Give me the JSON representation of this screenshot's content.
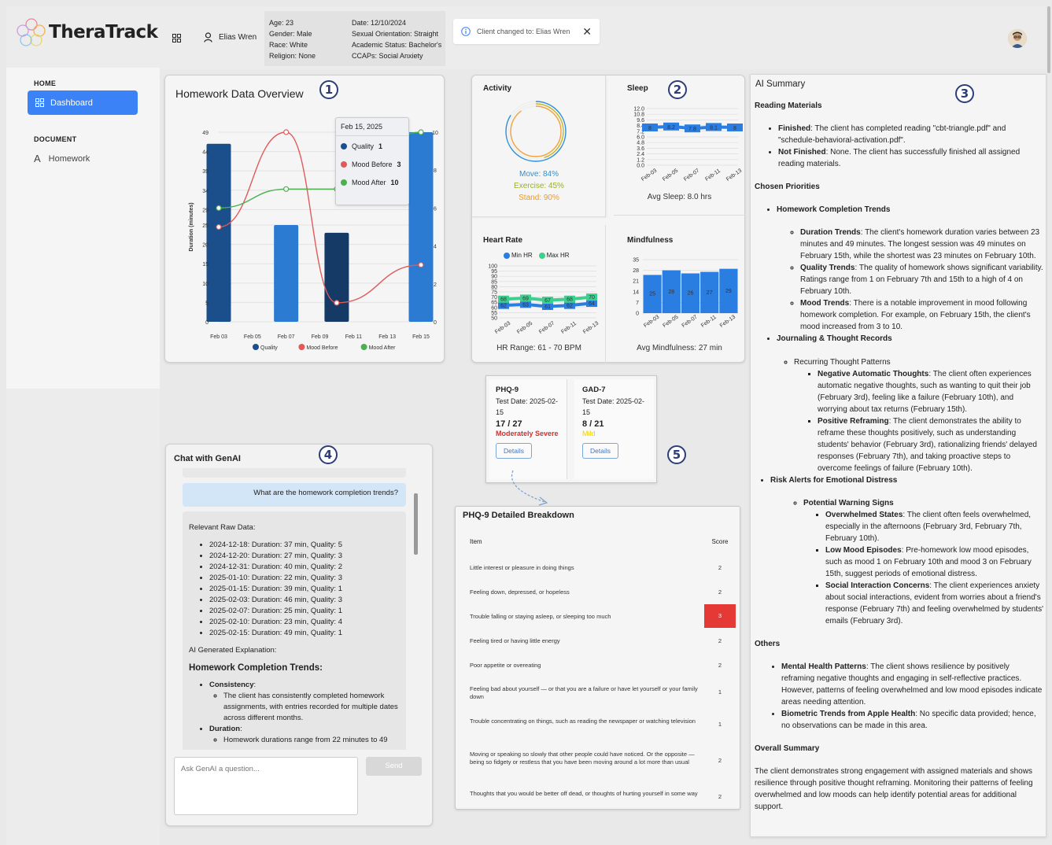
{
  "app": {
    "name": "TheraTrack"
  },
  "sidebar": {
    "section_home": "HOME",
    "dashboard": "Dashboard",
    "section_document": "DOCUMENT",
    "homework": "Homework"
  },
  "header": {
    "client_name": "Elias Wren",
    "age": "Age: 23",
    "gender": "Gender: Male",
    "race": "Race: White",
    "religion": "Religion: None",
    "date": "Date: 12/10/2024",
    "orientation": "Sexual Orientation: Straight",
    "academic": "Academic Status: Bachelor's",
    "ccaps": "CCAPs: Social Anxiety",
    "toast": "Client changed to: Elias Wren"
  },
  "badges": [
    "1",
    "2",
    "3",
    "4",
    "5"
  ],
  "homework_chart": {
    "title": "Homework Data Overview",
    "chart_data": {
      "type": "bar",
      "title": "Homework Data Overview",
      "categories": [
        "Feb 03",
        "Feb 05",
        "Feb 07",
        "Feb 09",
        "Feb 11",
        "Feb 13",
        "Feb 15"
      ],
      "ylabel": "Duration (minutes)",
      "y2label": "Mood Rating (1–10)",
      "y_ticks": [
        "0",
        "5",
        "10",
        "15",
        "20",
        "25",
        "29",
        "34",
        "39",
        "44",
        "49"
      ],
      "y2_ticks": [
        "0",
        "2",
        "4",
        "6",
        "8",
        "10"
      ],
      "ylim": [
        0,
        49
      ],
      "y2lim": [
        0,
        10
      ],
      "series": [
        {
          "name": "Quality",
          "type": "bar",
          "x": [
            "2025-02-03",
            "2025-02-07",
            "2025-02-10",
            "2025-02-15"
          ],
          "values": [
            46,
            25,
            23,
            49
          ],
          "colors": [
            "#1a4f8b",
            "#2a7bd1",
            "#163a66",
            "#2a7bd1"
          ]
        },
        {
          "name": "Mood Before",
          "type": "line",
          "color": "#e05a5a",
          "x": [
            "2025-02-03",
            "2025-02-07",
            "2025-02-10",
            "2025-02-15"
          ],
          "values": [
            5,
            10,
            1,
            3
          ]
        },
        {
          "name": "Mood After",
          "type": "line",
          "color": "#4caf50",
          "x": [
            "2025-02-03",
            "2025-02-07",
            "2025-02-10",
            "2025-02-15"
          ],
          "values": [
            6,
            7,
            7,
            10
          ]
        }
      ],
      "legend_position": "bottom"
    },
    "tooltip": {
      "date": "Feb 15, 2025",
      "quality_label": "Quality",
      "quality_value": "1",
      "mood_before_label": "Mood Before",
      "mood_before_value": "3",
      "mood_after_label": "Mood After",
      "mood_after_value": "10"
    },
    "legend": [
      "Quality",
      "Mood Before",
      "Mood After"
    ]
  },
  "activity": {
    "title": "Activity",
    "move": "Move: 84%",
    "exercise": "Exercise: 45%",
    "stand": "Stand: 90%",
    "rings": [
      0.84,
      0.45,
      0.9
    ],
    "ring_colors": [
      "#2a8fd8",
      "#c9b62e",
      "#f2a33a"
    ]
  },
  "sleep": {
    "title": "Sleep",
    "footer": "Avg Sleep: 8.0 hrs",
    "chart_data": {
      "type": "line",
      "title": "",
      "categories": [
        "Feb-03",
        "Feb-05",
        "Feb-07",
        "Feb-11",
        "Feb-13"
      ],
      "values": [
        8,
        8.2,
        7.8,
        8.1,
        8
      ],
      "labels": [
        "8",
        "8.2",
        "7.8",
        "8.1",
        "8"
      ],
      "y_ticks": [
        "12.0",
        "10.8",
        "9.6",
        "8.4",
        "7.2",
        "6.0",
        "4.8",
        "3.6",
        "2.4",
        "1.2",
        "0.0"
      ],
      "ylim": [
        0,
        12
      ]
    }
  },
  "heart": {
    "title": "Heart Rate",
    "footer": "HR Range: 61 - 70 BPM",
    "legend_min": "Min HR",
    "legend_max": "Max HR",
    "chart_data": {
      "type": "line",
      "title": "",
      "categories": [
        "Feb-03",
        "Feb-05",
        "Feb-07",
        "Feb-11",
        "Feb-13"
      ],
      "series": [
        {
          "name": "Min HR",
          "values": [
            62,
            63,
            61,
            62,
            64
          ],
          "labels": [
            "62",
            "63",
            "61",
            "62",
            "64"
          ],
          "color": "#2a7de1"
        },
        {
          "name": "Max HR",
          "values": [
            68,
            69,
            67,
            68,
            70
          ],
          "labels": [
            "68",
            "69",
            "67",
            "68",
            "70"
          ],
          "color": "#3ecf8e"
        }
      ],
      "y_ticks": [
        "100",
        "95",
        "90",
        "85",
        "80",
        "75",
        "70",
        "65",
        "60",
        "55",
        "50"
      ],
      "ylim": [
        50,
        100
      ]
    }
  },
  "mindful": {
    "title": "Mindfulness",
    "footer": "Avg Mindfulness: 27 min",
    "chart_data": {
      "type": "bar",
      "title": "",
      "categories": [
        "Feb-03",
        "Feb-05",
        "Feb-07",
        "Feb-11",
        "Feb-13"
      ],
      "values": [
        25,
        28,
        26,
        27,
        29
      ],
      "labels": [
        "25",
        "28",
        "26",
        "27",
        "29"
      ],
      "y_ticks": [
        "35",
        "28",
        "21",
        "14",
        "7",
        "0"
      ],
      "ylim": [
        0,
        35
      ]
    }
  },
  "ai_summary": {
    "title": "AI Summary",
    "reading_h": "Reading Materials",
    "finished_b": "Finished",
    "finished_t": ": The client has completed reading \"cbt-triangle.pdf\" and \"schedule-behavioral-activation.pdf\".",
    "notfinished_b": "Not Finished",
    "notfinished_t": ": None. The client has successfully finished all assigned reading materials.",
    "priorities_h": "Chosen Priorities",
    "hw_trends": "Homework Completion Trends",
    "dur_b": "Duration Trends",
    "dur_t": ": The client's homework duration varies between 23 minutes and 49 minutes. The longest session was 49 minutes on February 15th, while the shortest was 23 minutes on February 10th.",
    "qual_b": "Quality Trends",
    "qual_t": ": The quality of homework shows significant variability. Ratings range from 1 on February 7th and 15th to a high of 4 on February 10th.",
    "mood_b": "Mood Trends",
    "mood_t": ": There is a notable improvement in mood following homework completion. For example, on February 15th, the client's mood increased from 3 to 10.",
    "journal": "Journaling & Thought Records",
    "recurring": "Recurring Thought Patterns",
    "neg_b": "Negative Automatic Thoughts",
    "neg_t": ": The client often experiences automatic negative thoughts, such as wanting to quit their job (February 3rd), feeling like a failure (February 10th), and worrying about tax returns (February 15th).",
    "pos_b": "Positive Reframing",
    "pos_t": ": The client demonstrates the ability to reframe these thoughts positively, such as understanding students' behavior (February 3rd), rationalizing friends' delayed responses (February 7th), and taking proactive steps to overcome feelings of failure (February 10th).",
    "risk": "Risk Alerts for Emotional Distress",
    "warning": "Potential Warning Signs",
    "ow_b": "Overwhelmed States",
    "ow_t": ": The client often feels overwhelmed, especially in the afternoons (February 3rd, February 7th, February 10th).",
    "low_b": "Low Mood Episodes",
    "low_t": ": Pre-homework low mood episodes, such as mood 1 on February 10th and mood 3 on February 15th, suggest periods of emotional distress.",
    "soc_b": "Social Interaction Concerns",
    "soc_t": ": The client experiences anxiety about social interactions, evident from worries about a friend's response (February 7th) and feeling overwhelmed by students' emails (February 3rd).",
    "others_h": "Others",
    "mh_b": "Mental Health Patterns",
    "mh_t": ": The client shows resilience by positively reframing negative thoughts and engaging in self-reflective practices. However, patterns of feeling overwhelmed and low mood episodes indicate areas needing attention.",
    "bio_b": "Biometric Trends from Apple Health",
    "bio_t": ": No specific data provided; hence, no observations can be made in this area.",
    "overall_h": "Overall Summary",
    "overall_t": "The client demonstrates strong engagement with assigned materials and shows resilience through positive thought reframing. Monitoring their patterns of feeling overwhelmed and low moods can help identify potential areas for additional support."
  },
  "chat": {
    "title": "Chat with GenAI",
    "user_msg": "What are the homework completion trends?",
    "raw_h": "Relevant Raw Data:",
    "raw": [
      "2024-12-18: Duration: 37 min, Quality: 5",
      "2024-12-20: Duration: 27 min, Quality: 3",
      "2024-12-31: Duration: 40 min, Quality: 2",
      "2025-01-10: Duration: 22 min, Quality: 3",
      "2025-01-15: Duration: 39 min, Quality: 1",
      "2025-02-03: Duration: 46 min, Quality: 3",
      "2025-02-07: Duration: 25 min, Quality: 1",
      "2025-02-10: Duration: 23 min, Quality: 4",
      "2025-02-15: Duration: 49 min, Quality: 1"
    ],
    "expl": "AI Generated Explanation:",
    "trend_h": "Homework Completion Trends:",
    "consistency": "Consistency",
    "consistency_t": "The client has consistently completed homework assignments, with entries recorded for multiple dates across different months.",
    "duration": "Duration",
    "duration_t": "Homework durations range from 22 minutes to 49",
    "placeholder": "Ask GenAI a question...",
    "send": "Send"
  },
  "assess": {
    "phq": {
      "name": "PHQ-9",
      "date": "Test Date: 2025-02-15",
      "score": "17 / 27",
      "severity": "Moderately Severe",
      "details": "Details"
    },
    "gad": {
      "name": "GAD-7",
      "date": "Test Date: 2025-02-15",
      "score": "8 / 21",
      "severity": "Mild",
      "details": "Details"
    }
  },
  "phq_table": {
    "title": "PHQ-9 Detailed Breakdown",
    "col_item": "Item",
    "col_score": "Score",
    "rows": [
      {
        "item": "Little interest or pleasure in doing things",
        "score": "2"
      },
      {
        "item": "Feeling down, depressed, or hopeless",
        "score": "2"
      },
      {
        "item": "Trouble falling or staying asleep, or sleeping too much",
        "score": "3"
      },
      {
        "item": "Feeling tired or having little energy",
        "score": "2"
      },
      {
        "item": "Poor appetite or overeating",
        "score": "2"
      },
      {
        "item": "Feeling bad about yourself — or that you are a failure or have let yourself or your family down",
        "score": "1"
      },
      {
        "item": "Trouble concentrating on things, such as reading the newspaper or watching television",
        "score": "1"
      },
      {
        "item": "Moving or speaking so slowly that other people could have noticed. Or the opposite — being so fidgety or restless that you have been moving around a lot more than usual",
        "score": "2"
      },
      {
        "item": "Thoughts that you would be better off dead, or thoughts of hurting yourself in some way",
        "score": "2"
      }
    ]
  }
}
